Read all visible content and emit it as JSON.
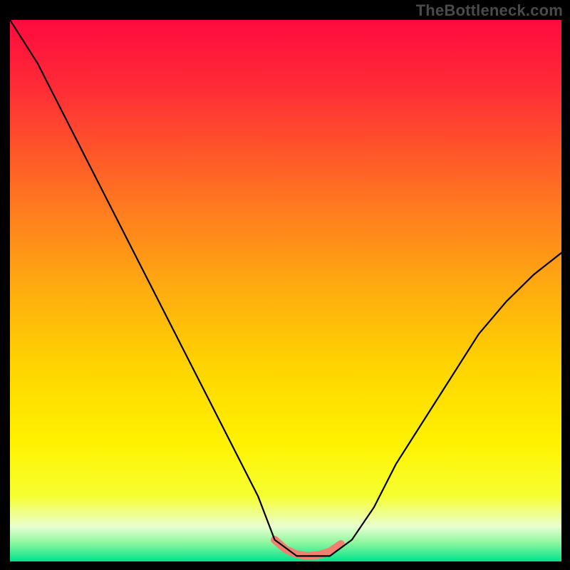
{
  "watermark": "TheBottleneck.com",
  "chart_data": {
    "type": "line",
    "title": "",
    "xlabel": "",
    "ylabel": "",
    "xlim": [
      0,
      100
    ],
    "ylim": [
      0,
      100
    ],
    "grid": false,
    "legend": false,
    "note": "No axis ticks or numeric labels are visible; values are normalized 0–100 estimated from pixel positions.",
    "series": [
      {
        "name": "bottleneck-curve",
        "color": "#000000",
        "x": [
          0,
          5,
          10,
          15,
          20,
          25,
          30,
          35,
          40,
          45,
          48,
          52,
          55,
          58,
          62,
          66,
          70,
          75,
          80,
          85,
          90,
          95,
          100
        ],
        "values": [
          100,
          92,
          82,
          72,
          62,
          52,
          42,
          32,
          22,
          12,
          4,
          1,
          1,
          1,
          4,
          10,
          18,
          26,
          34,
          42,
          48,
          53,
          57
        ]
      },
      {
        "name": "optimal-zone-highlight",
        "color": "#f08070",
        "x": [
          48,
          50,
          52,
          54,
          56,
          58,
          60
        ],
        "values": [
          4,
          2.2,
          1.3,
          1.0,
          1.2,
          1.8,
          3.2
        ]
      }
    ],
    "background_gradient": {
      "stops": [
        {
          "offset": 0.0,
          "color": "#ff0b3f"
        },
        {
          "offset": 0.12,
          "color": "#ff2a37"
        },
        {
          "offset": 0.3,
          "color": "#ff6a24"
        },
        {
          "offset": 0.48,
          "color": "#ffa712"
        },
        {
          "offset": 0.64,
          "color": "#ffd400"
        },
        {
          "offset": 0.78,
          "color": "#fff200"
        },
        {
          "offset": 0.88,
          "color": "#f6ff33"
        },
        {
          "offset": 0.935,
          "color": "#eaffd0"
        },
        {
          "offset": 0.965,
          "color": "#8ff7a0"
        },
        {
          "offset": 1.0,
          "color": "#00e38a"
        }
      ]
    }
  }
}
